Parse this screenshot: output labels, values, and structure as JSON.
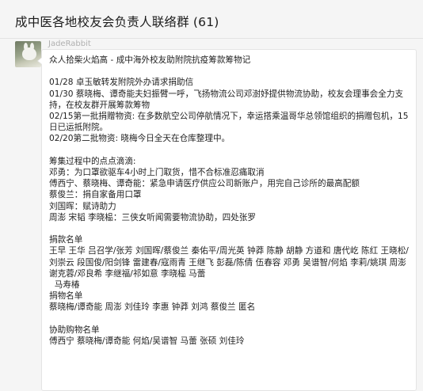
{
  "header": {
    "title": "成中医各地校友会负责人联络群 (61)"
  },
  "message": {
    "sender": "JadeRabbit",
    "avatar_icon": "rabbit-avatar",
    "lines": [
      "众人拾柴火焰高 - 成中海外校友助附院抗疫筹款筹物记",
      "",
      "01/28 卓玉敏转发附院外办请求捐助信",
      "01/30 蔡晓梅、谭奇能夫妇振臂一呼，飞扬物流公司邓澍妤提供物流协助，校友会理事会全力支持，在校友群开展筹款筹物",
      "02/15第一批捐赠物资: 在多数航空公司停航情况下，幸运搭乘温哥华总领馆组织的捐赠包机，15日已运抵附院。",
      "02/20第二批物资: 晓梅今日全天在仓库整理中。",
      "",
      "筹集过程中的点点滴滴:",
      "邓勇：为口罩欲驱车4小时上门取货，惜不合标准忍痛取消",
      "傅西宁、蔡晓梅、谭奇能：紧急申请医疗供应公司新账户，用完自己诊所的最高配额",
      "蔡俊兰：捐自家备用口罩",
      "刘国晖：赋诗助力",
      "周澎 宋韬 李晓榀：三侠女听闻需要物流协助，四处张罗",
      "",
      "捐款名单",
      "王早 王华 吕召学/张芳 刘国晖/蔡俊兰 秦佑平/周光英 钟莽 陈静 胡静 方道和 唐代屹 陈红 王晓松/刘崇云 段国俊/阳剑锋 雷建春/寇雨青 王继飞 彭磊/陈倩 伍春容 邓勇 吴谱智/何焰 李莉/姚琪 周澎 谢克蓉/邓良希 李继福/祁如意 李晓榀 马蕾",
      "  马寿椿",
      "捐物名单",
      "蔡晓梅/谭奇能 周澎 刘佳玲 李惠 钟莽 刘鸿 蔡俊兰 匿名",
      "",
      "协助购物名单",
      "傅西宁 蔡晓梅/谭奇能 何焰/吴谱智 马蕾 张硕 刘佳玲"
    ]
  }
}
